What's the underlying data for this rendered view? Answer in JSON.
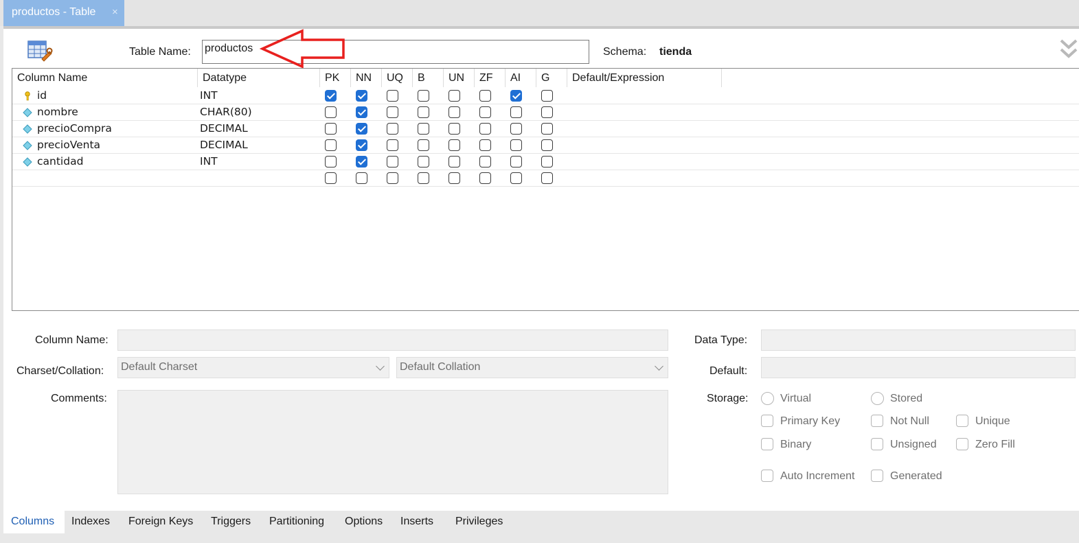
{
  "doc_tab": {
    "title": "productos - Table",
    "close": "×"
  },
  "header": {
    "table_name_label": "Table Name:",
    "table_name_value": "productos",
    "schema_label": "Schema:",
    "schema_value": "tienda"
  },
  "grid": {
    "headers": [
      "Column Name",
      "Datatype",
      "PK",
      "NN",
      "UQ",
      "B",
      "UN",
      "ZF",
      "AI",
      "G",
      "Default/Expression"
    ],
    "rows": [
      {
        "name": "id",
        "type": "INT",
        "icon": "key-icon",
        "flags": [
          true,
          true,
          false,
          false,
          false,
          false,
          true,
          false
        ]
      },
      {
        "name": "nombre",
        "type": "CHAR(80)",
        "icon": "column-diamond-icon",
        "flags": [
          false,
          true,
          false,
          false,
          false,
          false,
          false,
          false
        ]
      },
      {
        "name": "precioCompra",
        "type": "DECIMAL",
        "icon": "column-diamond-icon",
        "flags": [
          false,
          true,
          false,
          false,
          false,
          false,
          false,
          false
        ]
      },
      {
        "name": "precioVenta",
        "type": "DECIMAL",
        "icon": "column-diamond-icon",
        "flags": [
          false,
          true,
          false,
          false,
          false,
          false,
          false,
          false
        ]
      },
      {
        "name": "cantidad",
        "type": "INT",
        "icon": "column-diamond-icon",
        "flags": [
          false,
          true,
          false,
          false,
          false,
          false,
          false,
          false
        ]
      },
      {
        "name": "",
        "type": "",
        "icon": "",
        "flags": [
          false,
          false,
          false,
          false,
          false,
          false,
          false,
          false
        ]
      }
    ]
  },
  "details": {
    "column_name_label": "Column Name:",
    "charset_label": "Charset/Collation:",
    "charset_value": "Default Charset",
    "collation_value": "Default Collation",
    "comments_label": "Comments:",
    "data_type_label": "Data Type:",
    "default_label": "Default:",
    "storage_label": "Storage:",
    "storage_options": {
      "virtual": "Virtual",
      "stored": "Stored"
    },
    "options": {
      "primary_key": "Primary Key",
      "not_null": "Not Null",
      "unique": "Unique",
      "binary": "Binary",
      "unsigned": "Unsigned",
      "zero_fill": "Zero Fill",
      "auto_increment": "Auto Increment",
      "generated": "Generated"
    }
  },
  "bottom_tabs": {
    "columns": "Columns",
    "indexes": "Indexes",
    "foreign_keys": "Foreign Keys",
    "triggers": "Triggers",
    "partitioning": "Partitioning",
    "options": "Options",
    "inserts": "Inserts",
    "privileges": "Privileges",
    "active": "Columns"
  },
  "colors": {
    "tab_active_bg": "#8db7e6",
    "checkbox_checked": "#1f6fd4",
    "annotation_arrow": "#e8201e",
    "active_tab_text": "#1f5fb4"
  }
}
